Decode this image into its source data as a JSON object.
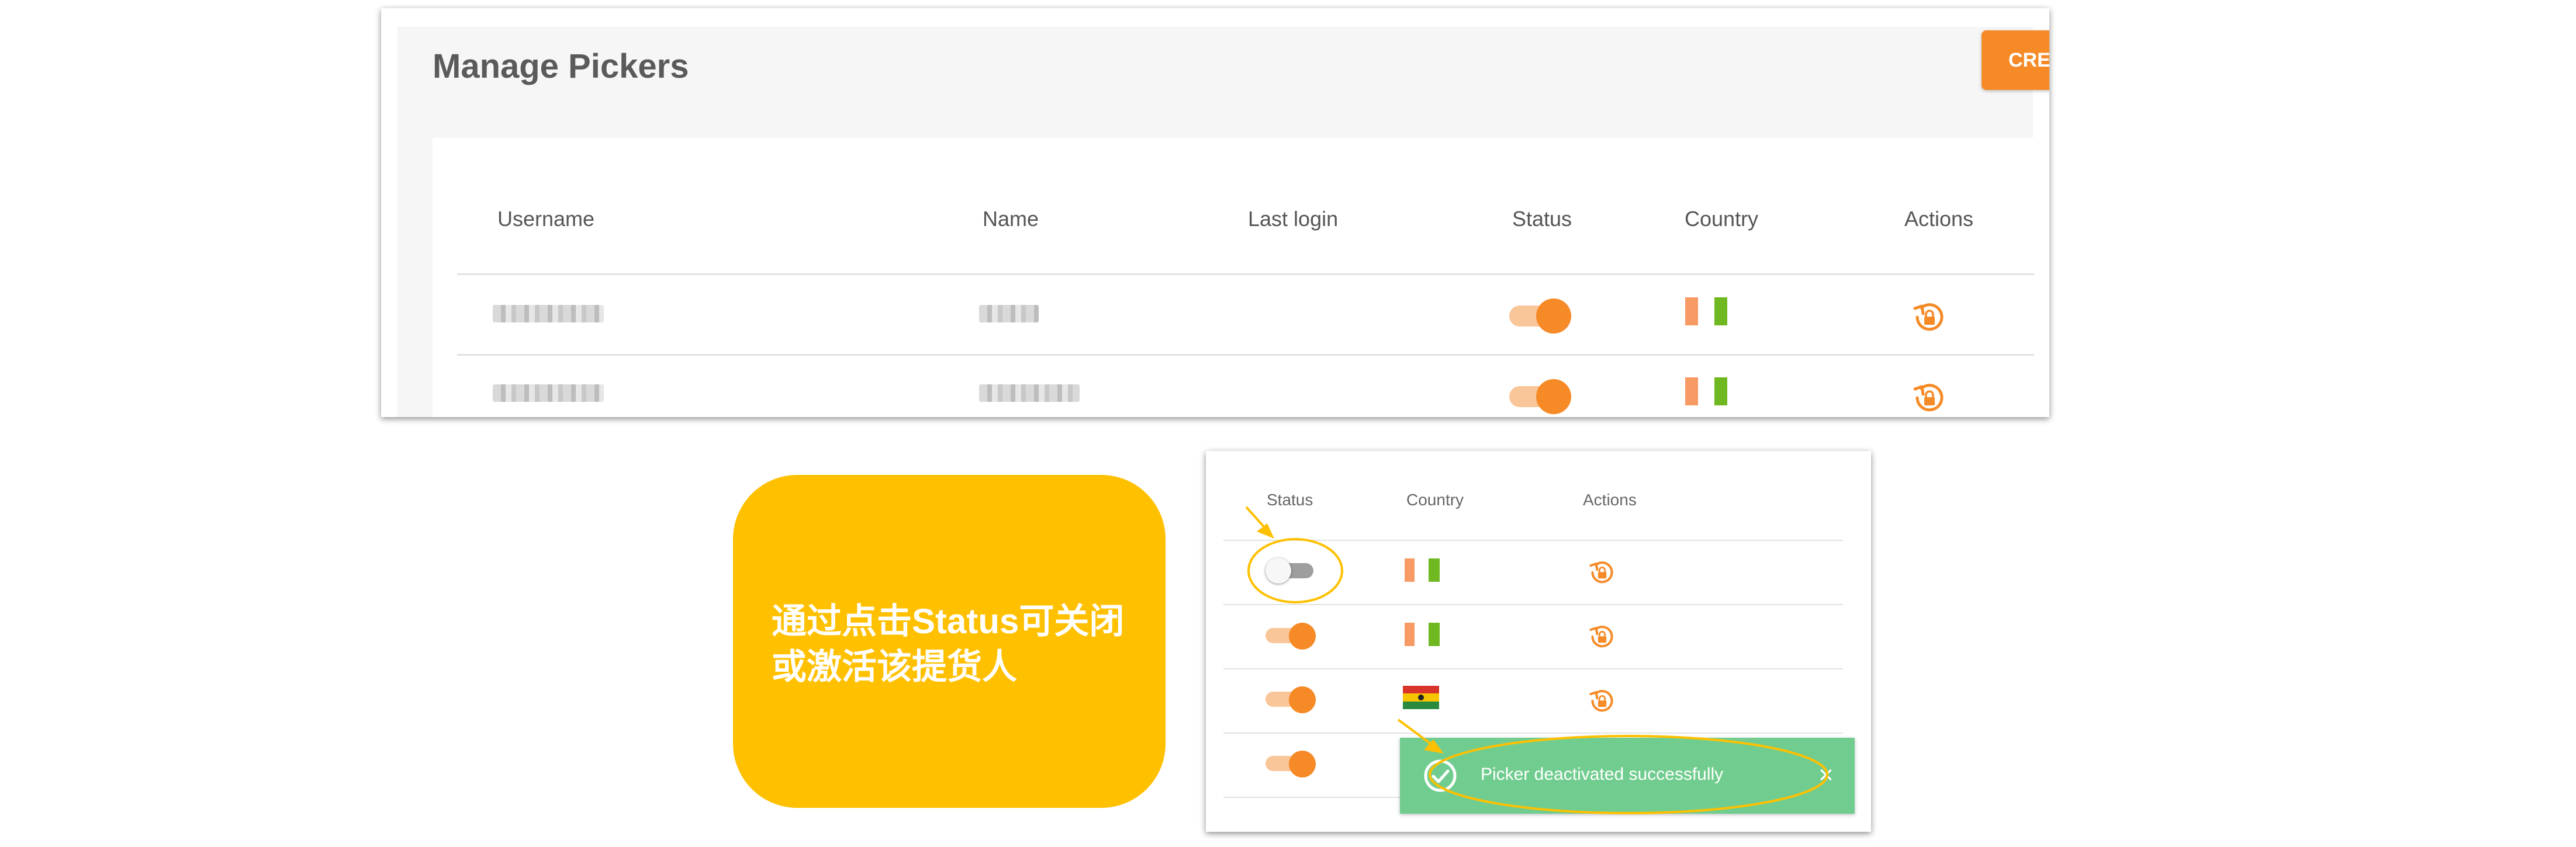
{
  "top": {
    "title": "Manage Pickers",
    "create_label": "CREA",
    "columns": {
      "username": "Username",
      "name": "Name",
      "last_login": "Last login",
      "status": "Status",
      "country": "Country",
      "actions": "Actions"
    },
    "rows": [
      {
        "username": "",
        "name": "",
        "last_login": "",
        "status_active": true
      },
      {
        "username": "",
        "name": "",
        "last_login": "",
        "status_active": true
      }
    ]
  },
  "callout": {
    "text": "通过点击Status可关闭或激活该提货人"
  },
  "bottom": {
    "columns": {
      "status": "Status",
      "country": "Country",
      "actions": "Actions"
    },
    "rows": [
      {
        "status_active": false,
        "country_flag": "orange-green"
      },
      {
        "status_active": true,
        "country_flag": "orange-green"
      },
      {
        "status_active": true,
        "country_flag": "ghana"
      },
      {
        "status_active": true,
        "country_flag": ""
      }
    ]
  },
  "toast": {
    "message": "Picker deactivated successfully",
    "close": "×"
  },
  "colors": {
    "accent": "#f58a27",
    "callout": "#ffc000",
    "toast": "#71cd8f"
  }
}
